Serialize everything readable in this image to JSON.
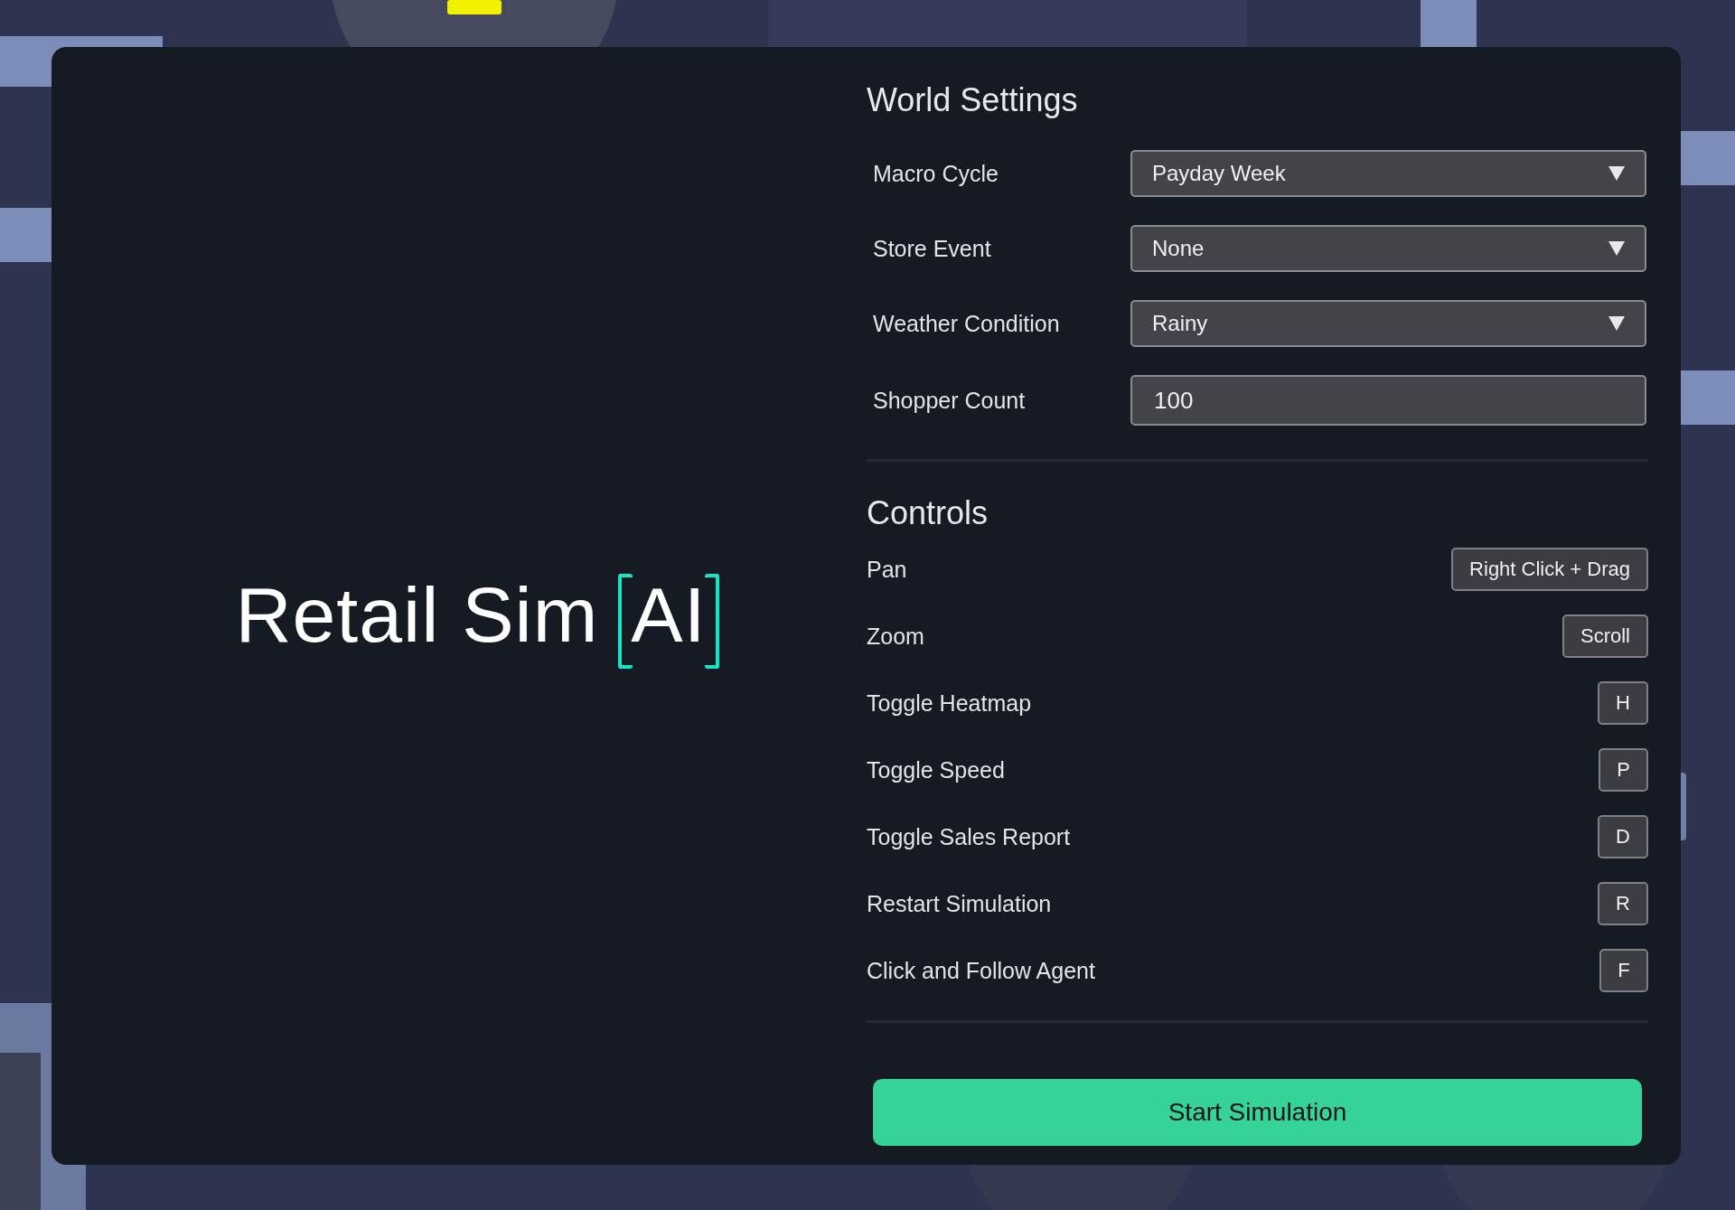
{
  "logo": {
    "text": "Retail Sim",
    "tag": "AI"
  },
  "world_settings": {
    "title": "World Settings",
    "fields": [
      {
        "label": "Macro Cycle",
        "kind": "select",
        "value": "Payday Week"
      },
      {
        "label": "Store Event",
        "kind": "select",
        "value": "None"
      },
      {
        "label": "Weather Condition",
        "kind": "select",
        "value": "Rainy"
      },
      {
        "label": "Shopper Count",
        "kind": "number",
        "value": "100"
      }
    ]
  },
  "controls": {
    "title": "Controls",
    "items": [
      {
        "action": "Pan",
        "key": "Right Click + Drag"
      },
      {
        "action": "Zoom",
        "key": "Scroll"
      },
      {
        "action": "Toggle Heatmap",
        "key": "H"
      },
      {
        "action": "Toggle Speed",
        "key": "P"
      },
      {
        "action": "Toggle Sales Report",
        "key": "D"
      },
      {
        "action": "Restart Simulation",
        "key": "R"
      },
      {
        "action": "Click and Follow Agent",
        "key": "F"
      }
    ]
  },
  "start_button": "Start Simulation"
}
